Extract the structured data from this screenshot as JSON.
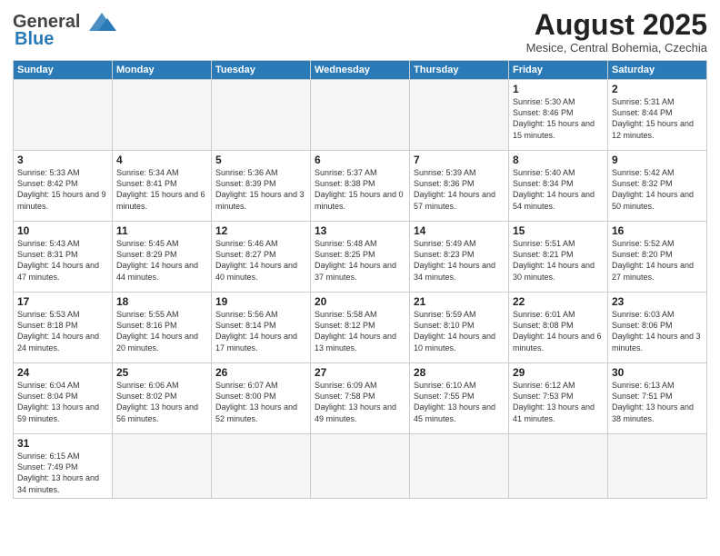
{
  "header": {
    "logo_general": "General",
    "logo_blue": "Blue",
    "month_title": "August 2025",
    "subtitle": "Mesice, Central Bohemia, Czechia"
  },
  "weekdays": [
    "Sunday",
    "Monday",
    "Tuesday",
    "Wednesday",
    "Thursday",
    "Friday",
    "Saturday"
  ],
  "weeks": [
    [
      {
        "day": "",
        "info": ""
      },
      {
        "day": "",
        "info": ""
      },
      {
        "day": "",
        "info": ""
      },
      {
        "day": "",
        "info": ""
      },
      {
        "day": "",
        "info": ""
      },
      {
        "day": "1",
        "info": "Sunrise: 5:30 AM\nSunset: 8:46 PM\nDaylight: 15 hours and 15 minutes."
      },
      {
        "day": "2",
        "info": "Sunrise: 5:31 AM\nSunset: 8:44 PM\nDaylight: 15 hours and 12 minutes."
      }
    ],
    [
      {
        "day": "3",
        "info": "Sunrise: 5:33 AM\nSunset: 8:42 PM\nDaylight: 15 hours and 9 minutes."
      },
      {
        "day": "4",
        "info": "Sunrise: 5:34 AM\nSunset: 8:41 PM\nDaylight: 15 hours and 6 minutes."
      },
      {
        "day": "5",
        "info": "Sunrise: 5:36 AM\nSunset: 8:39 PM\nDaylight: 15 hours and 3 minutes."
      },
      {
        "day": "6",
        "info": "Sunrise: 5:37 AM\nSunset: 8:38 PM\nDaylight: 15 hours and 0 minutes."
      },
      {
        "day": "7",
        "info": "Sunrise: 5:39 AM\nSunset: 8:36 PM\nDaylight: 14 hours and 57 minutes."
      },
      {
        "day": "8",
        "info": "Sunrise: 5:40 AM\nSunset: 8:34 PM\nDaylight: 14 hours and 54 minutes."
      },
      {
        "day": "9",
        "info": "Sunrise: 5:42 AM\nSunset: 8:32 PM\nDaylight: 14 hours and 50 minutes."
      }
    ],
    [
      {
        "day": "10",
        "info": "Sunrise: 5:43 AM\nSunset: 8:31 PM\nDaylight: 14 hours and 47 minutes."
      },
      {
        "day": "11",
        "info": "Sunrise: 5:45 AM\nSunset: 8:29 PM\nDaylight: 14 hours and 44 minutes."
      },
      {
        "day": "12",
        "info": "Sunrise: 5:46 AM\nSunset: 8:27 PM\nDaylight: 14 hours and 40 minutes."
      },
      {
        "day": "13",
        "info": "Sunrise: 5:48 AM\nSunset: 8:25 PM\nDaylight: 14 hours and 37 minutes."
      },
      {
        "day": "14",
        "info": "Sunrise: 5:49 AM\nSunset: 8:23 PM\nDaylight: 14 hours and 34 minutes."
      },
      {
        "day": "15",
        "info": "Sunrise: 5:51 AM\nSunset: 8:21 PM\nDaylight: 14 hours and 30 minutes."
      },
      {
        "day": "16",
        "info": "Sunrise: 5:52 AM\nSunset: 8:20 PM\nDaylight: 14 hours and 27 minutes."
      }
    ],
    [
      {
        "day": "17",
        "info": "Sunrise: 5:53 AM\nSunset: 8:18 PM\nDaylight: 14 hours and 24 minutes."
      },
      {
        "day": "18",
        "info": "Sunrise: 5:55 AM\nSunset: 8:16 PM\nDaylight: 14 hours and 20 minutes."
      },
      {
        "day": "19",
        "info": "Sunrise: 5:56 AM\nSunset: 8:14 PM\nDaylight: 14 hours and 17 minutes."
      },
      {
        "day": "20",
        "info": "Sunrise: 5:58 AM\nSunset: 8:12 PM\nDaylight: 14 hours and 13 minutes."
      },
      {
        "day": "21",
        "info": "Sunrise: 5:59 AM\nSunset: 8:10 PM\nDaylight: 14 hours and 10 minutes."
      },
      {
        "day": "22",
        "info": "Sunrise: 6:01 AM\nSunset: 8:08 PM\nDaylight: 14 hours and 6 minutes."
      },
      {
        "day": "23",
        "info": "Sunrise: 6:03 AM\nSunset: 8:06 PM\nDaylight: 14 hours and 3 minutes."
      }
    ],
    [
      {
        "day": "24",
        "info": "Sunrise: 6:04 AM\nSunset: 8:04 PM\nDaylight: 13 hours and 59 minutes."
      },
      {
        "day": "25",
        "info": "Sunrise: 6:06 AM\nSunset: 8:02 PM\nDaylight: 13 hours and 56 minutes."
      },
      {
        "day": "26",
        "info": "Sunrise: 6:07 AM\nSunset: 8:00 PM\nDaylight: 13 hours and 52 minutes."
      },
      {
        "day": "27",
        "info": "Sunrise: 6:09 AM\nSunset: 7:58 PM\nDaylight: 13 hours and 49 minutes."
      },
      {
        "day": "28",
        "info": "Sunrise: 6:10 AM\nSunset: 7:55 PM\nDaylight: 13 hours and 45 minutes."
      },
      {
        "day": "29",
        "info": "Sunrise: 6:12 AM\nSunset: 7:53 PM\nDaylight: 13 hours and 41 minutes."
      },
      {
        "day": "30",
        "info": "Sunrise: 6:13 AM\nSunset: 7:51 PM\nDaylight: 13 hours and 38 minutes."
      }
    ],
    [
      {
        "day": "31",
        "info": "Sunrise: 6:15 AM\nSunset: 7:49 PM\nDaylight: 13 hours and 34 minutes."
      },
      {
        "day": "",
        "info": ""
      },
      {
        "day": "",
        "info": ""
      },
      {
        "day": "",
        "info": ""
      },
      {
        "day": "",
        "info": ""
      },
      {
        "day": "",
        "info": ""
      },
      {
        "day": "",
        "info": ""
      }
    ]
  ]
}
